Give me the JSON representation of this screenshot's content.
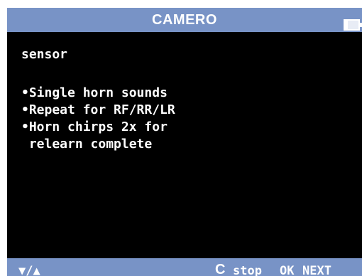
{
  "header": {
    "title": "CAMERO",
    "battery_icon": "battery-icon",
    "bar_color": "#7893c6"
  },
  "screen": {
    "background": "#000000",
    "lines": [
      "sensor",
      "",
      "•Single horn sounds",
      "•Repeat for RF/RR/LR",
      "•Horn chirps 2x for",
      " relearn complete"
    ]
  },
  "footer": {
    "nav_arrows": "▼/▲",
    "c_key": "C",
    "stop_label": "stop",
    "ok_label": "OK",
    "next_label": "NEXT"
  }
}
